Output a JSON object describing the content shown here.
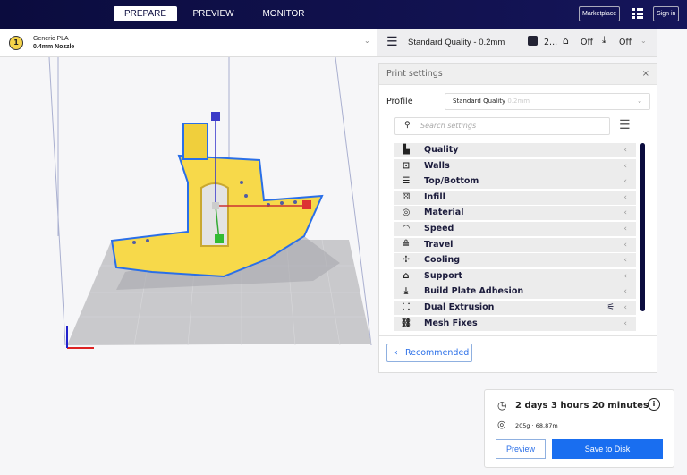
{
  "header": {
    "tabs": [
      "PREPARE",
      "PREVIEW",
      "MONITOR"
    ],
    "active_tab": "PREPARE",
    "marketplace": "Marketplace",
    "sign_in": "Sign in"
  },
  "printer": {
    "extruder_number": "1",
    "material": "Generic PLA",
    "nozzle": "0.4mm Nozzle"
  },
  "quick_settings": {
    "profile": "Standard Quality - 0.2mm",
    "infill": "2...",
    "support": "Off",
    "adhesion": "Off"
  },
  "print_settings": {
    "title": "Print settings",
    "profile_label": "Profile",
    "profile_value": "Standard Quality",
    "profile_suffix": "0.2mm",
    "search_placeholder": "Search settings",
    "categories": [
      {
        "label": "Quality",
        "icon": "▙"
      },
      {
        "label": "Walls",
        "icon": "⊡"
      },
      {
        "label": "Top/Bottom",
        "icon": "☰"
      },
      {
        "label": "Infill",
        "icon": "⚄"
      },
      {
        "label": "Material",
        "icon": "◎"
      },
      {
        "label": "Speed",
        "icon": "◠"
      },
      {
        "label": "Travel",
        "icon": "≗"
      },
      {
        "label": "Cooling",
        "icon": "✢"
      },
      {
        "label": "Support",
        "icon": "⌂"
      },
      {
        "label": "Build Plate Adhesion",
        "icon": "⤓"
      },
      {
        "label": "Dual Extrusion",
        "icon": "⸬"
      },
      {
        "label": "Mesh Fixes",
        "icon": "⛓"
      }
    ],
    "recommended": "Recommended"
  },
  "summary": {
    "time": "2 days 3 hours 20 minutes",
    "material": "205g · 68.87m",
    "preview": "Preview",
    "save": "Save to Disk"
  },
  "colors": {
    "header": "#0b0c3e",
    "accent": "#196ef0",
    "model": "#f7d94a"
  }
}
